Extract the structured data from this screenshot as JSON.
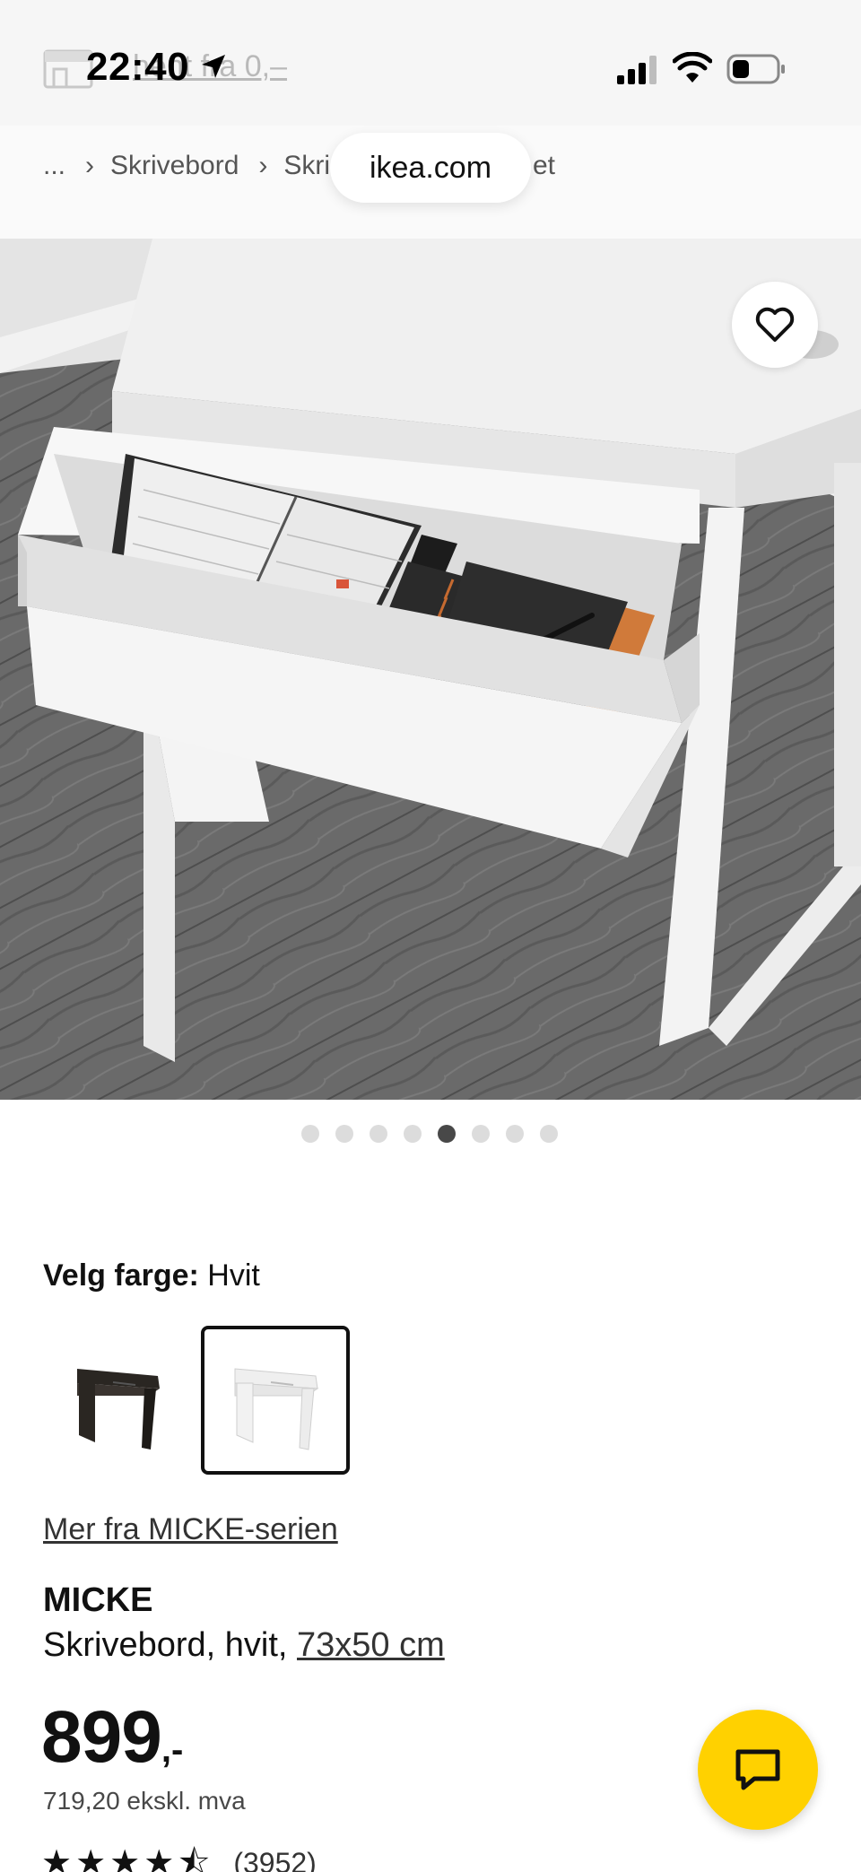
{
  "status_bar": {
    "time": "22:40",
    "behind_text": "hent fra 0,–"
  },
  "breadcrumb": {
    "items": [
      "...",
      "Skrivebord",
      "Skri"
    ],
    "trailing": "et",
    "url": "ikea.com"
  },
  "gallery": {
    "dot_count": 8,
    "active_index": 4
  },
  "color_select": {
    "label": "Velg farge:",
    "value": "Hvit",
    "options": [
      "svartbrun",
      "hvit"
    ],
    "selected_index": 1
  },
  "series_link": "Mer fra MICKE-serien",
  "product": {
    "name": "MICKE",
    "desc_prefix": "Skrivebord, hvit, ",
    "size": "73x50 cm",
    "price_amount": "899",
    "price_suffix": ",-",
    "price_ex_vat": "719,20 ekskl. mva",
    "rating_count": "(3952)",
    "rating_stars": 4.5
  },
  "icons": {
    "favorite": "heart-icon",
    "chat": "chat-bubble-icon",
    "location": "location-arrow-icon",
    "signal": "signal-icon",
    "wifi": "wifi-icon",
    "battery": "battery-icon",
    "store": "store-icon"
  },
  "colors": {
    "accent_yellow": "#ffd100",
    "text": "#111111",
    "dot_active": "#484848",
    "dot_inactive": "#dcdcdc"
  }
}
